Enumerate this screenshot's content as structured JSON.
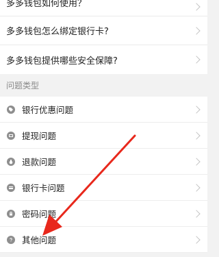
{
  "faq": {
    "items": [
      {
        "label": "多多钱包如何使用？"
      },
      {
        "label": "多多钱包怎么绑定银行卡?"
      },
      {
        "label": "多多钱包提供哪些安全保障?"
      }
    ]
  },
  "section": {
    "title": "问题类型"
  },
  "categories": [
    {
      "label": "银行优惠问题",
      "icon": "tag-icon"
    },
    {
      "label": "提现问题",
      "icon": "withdraw-icon"
    },
    {
      "label": "退款问题",
      "icon": "refund-icon"
    },
    {
      "label": "银行卡问题",
      "icon": "bank-card-icon"
    },
    {
      "label": "密码问题",
      "icon": "lock-icon"
    },
    {
      "label": "其他问题",
      "icon": "question-icon"
    }
  ],
  "colors": {
    "arrow": "#e8281c"
  }
}
